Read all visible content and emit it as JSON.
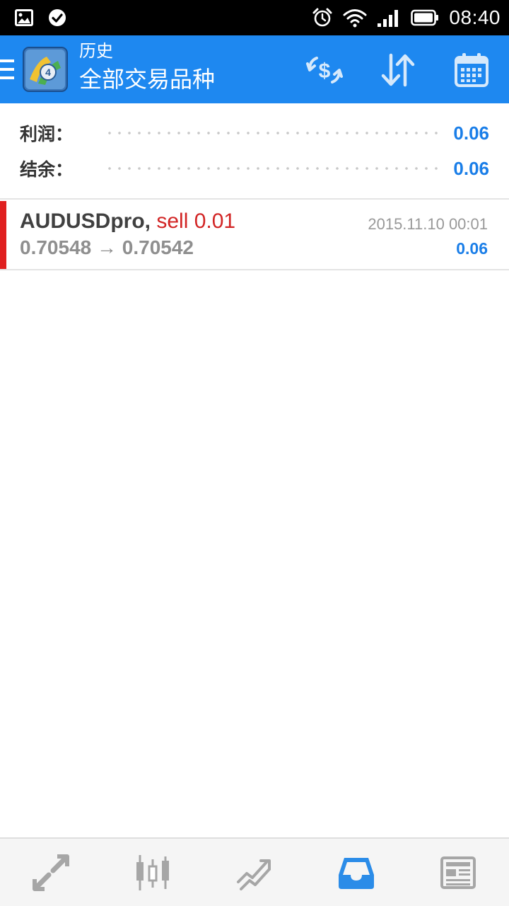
{
  "status_bar": {
    "time": "08:40",
    "icons": [
      "image-icon",
      "check-circle-icon",
      "alarm-icon",
      "wifi-icon",
      "signal-icon",
      "battery-icon"
    ]
  },
  "app_bar": {
    "subtitle": "历史",
    "title": "全部交易品种",
    "actions": [
      "currency-exchange-icon",
      "sort-icon",
      "calendar-icon"
    ],
    "color": "#1e88f0"
  },
  "summary": {
    "profit_label": "利润：",
    "profit_value": "0.06",
    "balance_label": "结余：",
    "balance_value": "0.06"
  },
  "trades": [
    {
      "symbol": "AUDUSDpro,",
      "side": "sell 0.01",
      "prices": "0.70548 → 0.70542",
      "time": "2015.11.10 00:01",
      "profit": "0.06"
    }
  ],
  "bottom_nav": {
    "items": [
      "quotes-icon",
      "chart-icon",
      "trade-icon",
      "history-icon",
      "news-icon"
    ],
    "active": "history-icon",
    "active_color": "#2b8ce8",
    "inactive_color": "#a6a6a6"
  }
}
